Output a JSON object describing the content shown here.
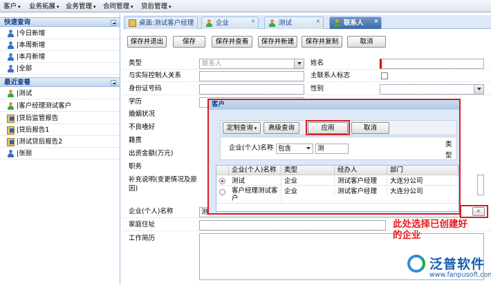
{
  "menubar": {
    "items": [
      {
        "label": "客户"
      },
      {
        "label": "业务拓展"
      },
      {
        "label": "业务管理"
      },
      {
        "label": "合同管理"
      },
      {
        "label": "贷后管理"
      }
    ]
  },
  "sidebar": {
    "quick": {
      "title": "快速查询",
      "items": [
        {
          "label": "|今日新增"
        },
        {
          "label": "|本周新增"
        },
        {
          "label": "|本月新增"
        },
        {
          "label": "|全部"
        }
      ]
    },
    "recent": {
      "title": "最近查看",
      "items": [
        {
          "label": "|测试"
        },
        {
          "label": "|客户经理测试客户"
        },
        {
          "label": "|贷后监管报告"
        },
        {
          "label": "|贷后报告1"
        },
        {
          "label": "|测试贷后报告2"
        },
        {
          "label": "|张丽"
        }
      ]
    }
  },
  "tabs": [
    {
      "label": "桌面:测试客户经理"
    },
    {
      "label": "企业"
    },
    {
      "label": "测试"
    },
    {
      "label": "联系人"
    }
  ],
  "toolbar": {
    "buttons": [
      {
        "label": "保存并退出"
      },
      {
        "label": "保存"
      },
      {
        "label": "保存并查看"
      },
      {
        "label": "保存并新建"
      },
      {
        "label": "保存并复制"
      },
      {
        "label": "取消"
      }
    ]
  },
  "form": {
    "type_label": "类型",
    "type_placeholder": "联系人",
    "name_label": "姓名",
    "relation_label": "与实际控制人关系",
    "primary_label": "主联系人标志",
    "idcard_label": "身份证号码",
    "gender_label": "性别",
    "education_label": "学历",
    "marriage_label": "婚姻状况",
    "bad_habit_label": "不良嗜好",
    "native_label": "籍贯",
    "capital_label": "出资金额(万元)",
    "position_label": "职务",
    "remark_label": "补充说明(变更情况及原因)",
    "company_label": "企业(个人)名称",
    "company_value": "测",
    "address_label": "家庭住址",
    "resume_label": "工作简历"
  },
  "dialog": {
    "title": "客户",
    "buttons": [
      {
        "label": "定制查询"
      },
      {
        "label": "高级查询"
      },
      {
        "label": "应用"
      },
      {
        "label": "取消"
      }
    ],
    "filter": {
      "field_label": "企业(个人)名称",
      "operator": "包含",
      "value": "测",
      "type_label": "类型"
    },
    "grid": {
      "columns": [
        {
          "label": "企业(个人)名称"
        },
        {
          "label": "类型"
        },
        {
          "label": "经办人"
        },
        {
          "label": "部门"
        }
      ],
      "rows": [
        {
          "selected": true,
          "name": "测试",
          "type": "企业",
          "handler": "测试客户经理",
          "dept": "大连分公司"
        },
        {
          "selected": false,
          "name": "客户经理测试客户",
          "type": "企业",
          "handler": "测试客户经理",
          "dept": "大连分公司"
        }
      ]
    }
  },
  "annotation": "此处选择已创建好的企业",
  "watermark": {
    "name": "泛普软件",
    "url": "www.fanpusoft.com"
  }
}
